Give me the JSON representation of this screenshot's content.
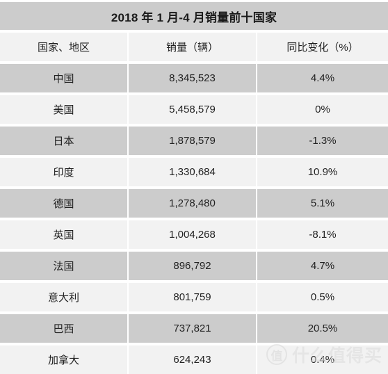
{
  "table": {
    "title": "2018 年 1 月-4 月销量前十国家",
    "columns": [
      "国家、地区",
      "销量（辆）",
      "同比变化（%）"
    ],
    "rows": [
      {
        "country": "中国",
        "sales": "8,345,523",
        "change": "4.4%"
      },
      {
        "country": "美国",
        "sales": "5,458,579",
        "change": "0%"
      },
      {
        "country": "日本",
        "sales": "1,878,579",
        "change": "-1.3%"
      },
      {
        "country": "印度",
        "sales": "1,330,684",
        "change": "10.9%"
      },
      {
        "country": "德国",
        "sales": "1,278,480",
        "change": "5.1%"
      },
      {
        "country": "英国",
        "sales": "1,004,268",
        "change": "-8.1%"
      },
      {
        "country": "法国",
        "sales": "896,792",
        "change": "4.7%"
      },
      {
        "country": "意大利",
        "sales": "801,759",
        "change": "0.5%"
      },
      {
        "country": "巴西",
        "sales": "737,821",
        "change": "20.5%"
      },
      {
        "country": "加拿大",
        "sales": "624,243",
        "change": "0.4%"
      }
    ]
  },
  "watermark": {
    "logo_text": "值",
    "text": "什么值得买"
  },
  "colors": {
    "band_dark": "#cccccc",
    "band_light": "#f2f2f2",
    "page_background": "#ffffff",
    "text": "#222222"
  }
}
